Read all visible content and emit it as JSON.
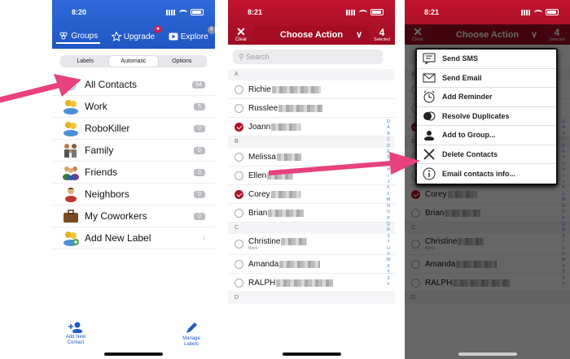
{
  "panel1": {
    "time": "8:20",
    "tabs": [
      {
        "label": "Groups"
      },
      {
        "label": "Upgrade"
      },
      {
        "label": "Explore",
        "badge": "9"
      }
    ],
    "segments": [
      "Labels",
      "Automatic",
      "Options"
    ],
    "groups": [
      {
        "name": "All Contacts",
        "count": "94"
      },
      {
        "name": "Work",
        "count": "5"
      },
      {
        "name": "RoboKiller",
        "count": "0"
      },
      {
        "name": "Family",
        "count": "0"
      },
      {
        "name": "Friends",
        "count": "0"
      },
      {
        "name": "Neighbors",
        "count": "0"
      },
      {
        "name": "My Coworkers",
        "count": "0"
      },
      {
        "name": "Add New Label"
      }
    ],
    "bottom": {
      "add_contact": "Add New Contact",
      "manage_labels": "Manage Labels"
    }
  },
  "panel2": {
    "time": "8:21",
    "clear_label": "Clear",
    "choose_label": "Choose Action",
    "selected_count": "4",
    "selected_label": "Selected",
    "search_placeholder": "Search",
    "sections": {
      "a": "A",
      "b": "B",
      "c": "C",
      "d": "D"
    },
    "contacts_a": [
      "Richie",
      "Russlee",
      "Joann"
    ],
    "contacts_b": [
      "Melissa",
      "Ellen",
      "Corey",
      "Brian"
    ],
    "contacts_c": [
      "Christine",
      "Amanda",
      "RALPH"
    ],
    "christine_sub": "Work",
    "index_letters": "Q A B C D E F G H I J K L M N O P Q R S T U V W X Y Z #"
  },
  "panel3": {
    "time": "8:21",
    "menu": [
      {
        "label": "Send SMS",
        "icon": "sms-icon"
      },
      {
        "label": "Send Email",
        "icon": "email-icon"
      },
      {
        "label": "Add Reminder",
        "icon": "alarm-icon"
      },
      {
        "label": "Resolve Duplicates",
        "icon": "duplicates-icon"
      },
      {
        "label": "Add to Group...",
        "icon": "group-icon"
      },
      {
        "label": "Delete Contacts",
        "icon": "delete-x-icon"
      },
      {
        "label": "Email contacts info...",
        "icon": "info-icon"
      }
    ]
  },
  "colors": {
    "blue": "#2f6ad8",
    "red": "#c2142f",
    "arrow": "#e8417d"
  }
}
